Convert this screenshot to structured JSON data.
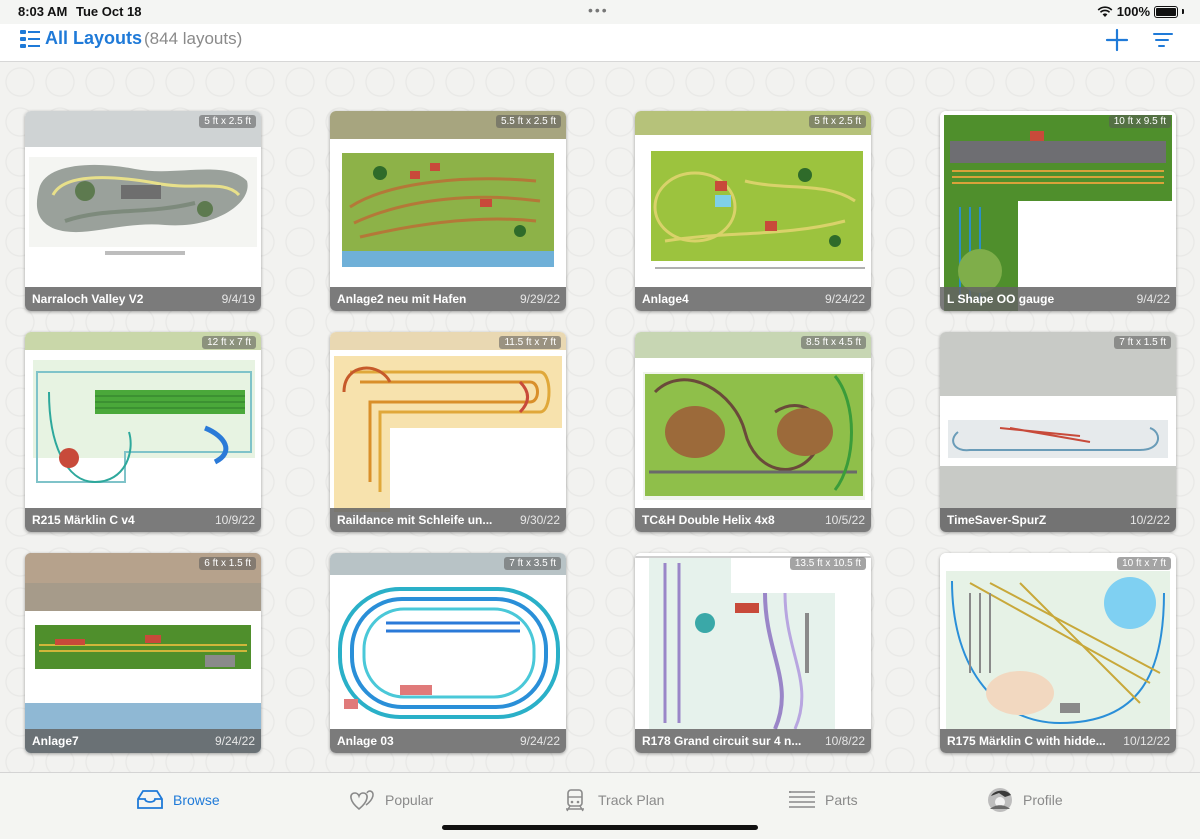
{
  "status": {
    "time": "8:03 AM",
    "date": "Tue Oct 18",
    "battery": "100%"
  },
  "nav": {
    "title": "All Layouts",
    "count": "(844 layouts)"
  },
  "layouts": [
    {
      "name": "Narraloch Valley V2",
      "date": "9/4/19",
      "size": "5 ft x 2.5 ft"
    },
    {
      "name": "Anlage2 neu mit Hafen",
      "date": "9/29/22",
      "size": "5.5 ft x 2.5 ft"
    },
    {
      "name": "Anlage4",
      "date": "9/24/22",
      "size": "5 ft x 2.5 ft"
    },
    {
      "name": "L Shape OO gauge",
      "date": "9/4/22",
      "size": "10 ft x 9.5 ft"
    },
    {
      "name": "R215 Märklin C v4",
      "date": "10/9/22",
      "size": "12 ft x 7 ft"
    },
    {
      "name": "Raildance mit Schleife un...",
      "date": "9/30/22",
      "size": "11.5 ft x 7 ft"
    },
    {
      "name": "TC&H Double Helix 4x8",
      "date": "10/5/22",
      "size": "8.5 ft x 4.5 ft"
    },
    {
      "name": "TimeSaver-SpurZ",
      "date": "10/2/22",
      "size": "7 ft x 1.5 ft"
    },
    {
      "name": "Anlage7",
      "date": "9/24/22",
      "size": "6 ft x 1.5 ft"
    },
    {
      "name": "Anlage 03",
      "date": "9/24/22",
      "size": "7 ft x 3.5 ft"
    },
    {
      "name": "R178 Grand circuit sur 4 n...",
      "date": "10/8/22",
      "size": "13.5 ft x 10.5 ft"
    },
    {
      "name": "R175 Märklin C with hidde...",
      "date": "10/12/22",
      "size": "10 ft x 7 ft"
    }
  ],
  "tabs": [
    {
      "label": "Browse",
      "icon": "tray-icon"
    },
    {
      "label": "Popular",
      "icon": "hearts-icon"
    },
    {
      "label": "Track Plan",
      "icon": "train-icon"
    },
    {
      "label": "Parts",
      "icon": "list-icon"
    },
    {
      "label": "Profile",
      "icon": "avatar-icon"
    }
  ],
  "colors": {
    "accent": "#1f7ad8",
    "footer": "#646464"
  }
}
